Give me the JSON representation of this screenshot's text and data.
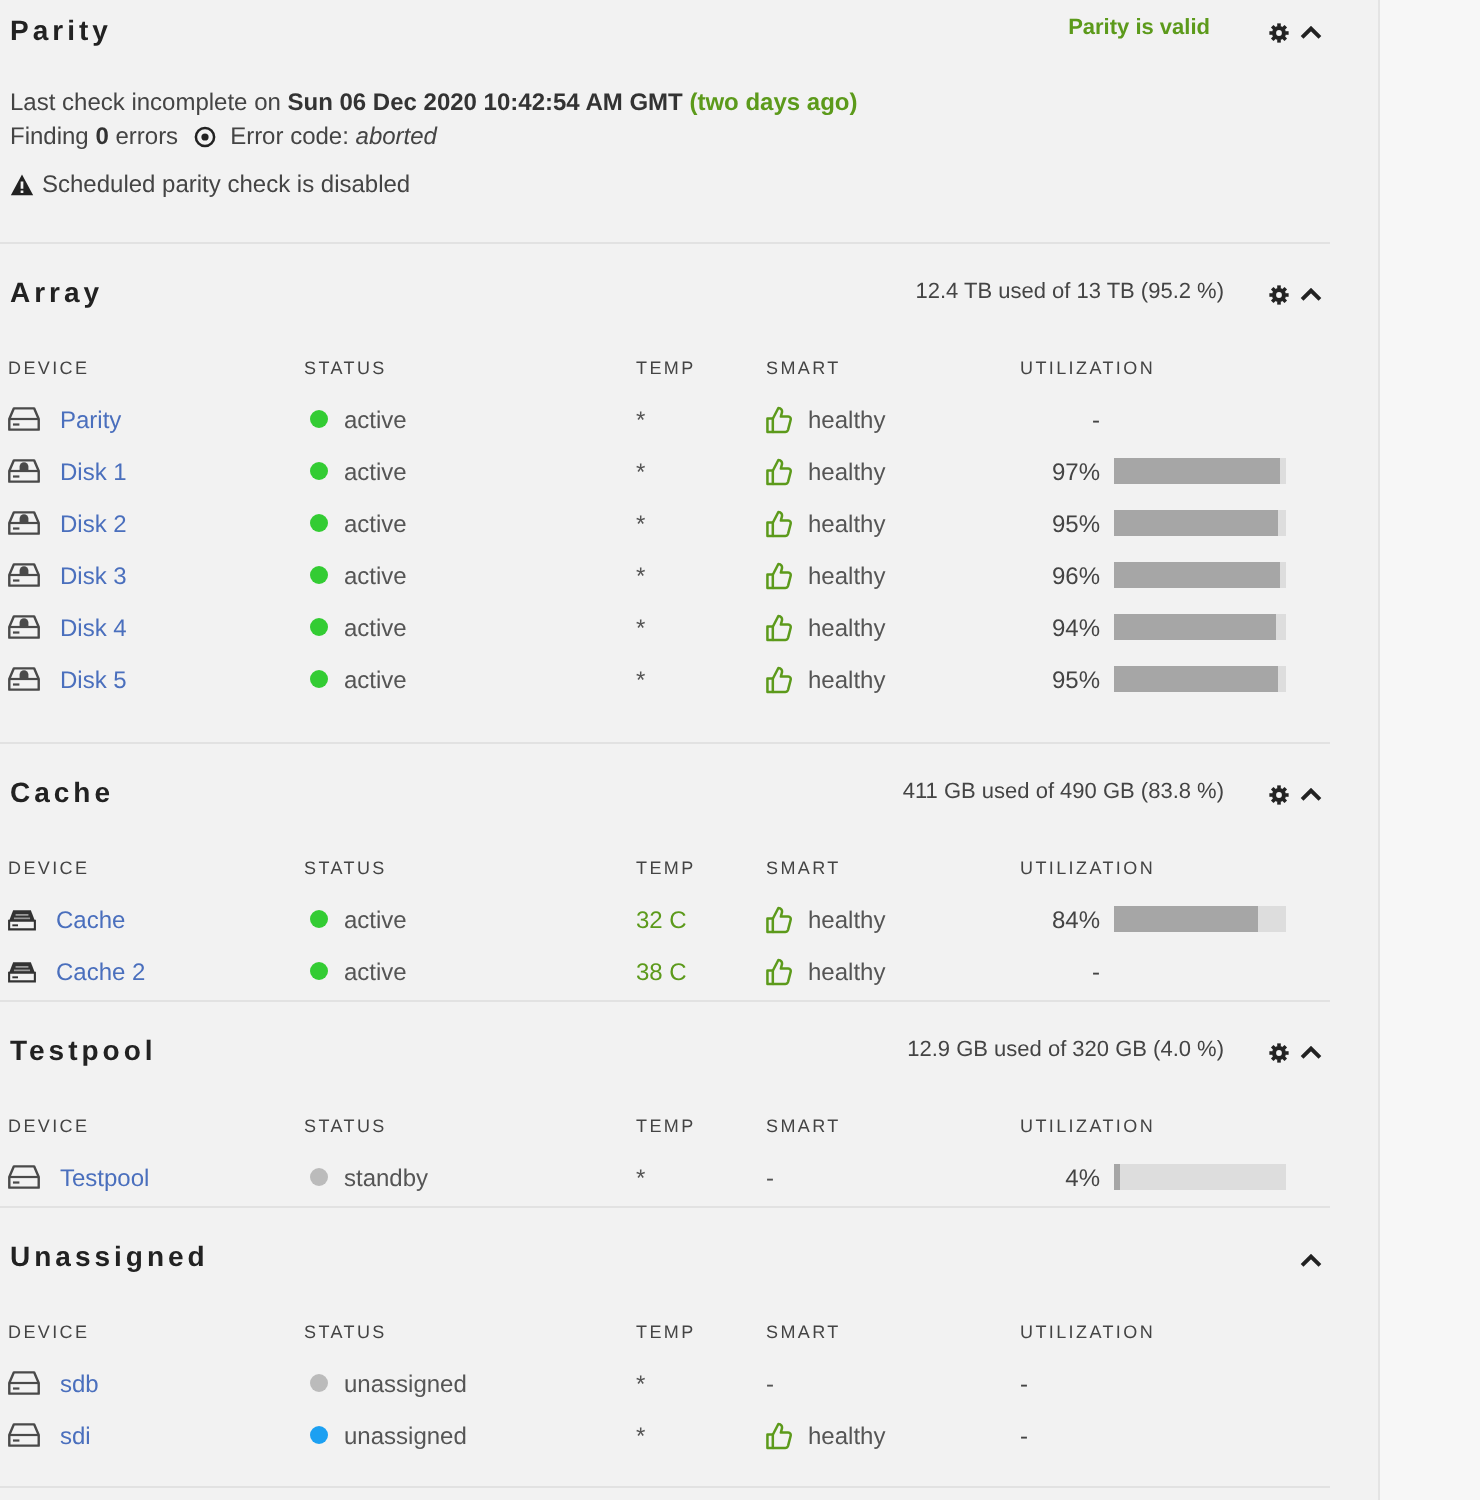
{
  "parity": {
    "title": "Parity",
    "status": "Parity is valid",
    "settings": true,
    "expanded": true,
    "last_check": "Last check incomplete on **Sun 06 Dec 2020 10:42:54 AM GMT**",
    "last_check_age": "(two days ago)",
    "findings": "Finding **0** errors",
    "error_code": "Error code: *aborted*",
    "schedule_warning": "Scheduled parity check is disabled"
  },
  "sections": [
    {
      "kind": "array",
      "title": "Array",
      "usage": "12.4 TB used of 13 TB (95.2 %)",
      "settings": true,
      "expanded": true,
      "columns": [
        "DEVICE",
        "STATUS",
        "TEMP",
        "SMART",
        "UTILIZATION"
      ],
      "devices": [
        {
          "kind": "plain",
          "name": "Parity",
          "status": "active",
          "color": "#33cc33",
          "temp": "*",
          "temp_normal": false,
          "smart": "healthy",
          "smart_ok": true,
          "utilization": "-"
        },
        {
          "kind": "locked",
          "name": "Disk 1",
          "status": "active",
          "color": "#33cc33",
          "temp": "*",
          "temp_normal": false,
          "smart": "healthy",
          "smart_ok": true,
          "utilization": "97%",
          "level": 0.97
        },
        {
          "kind": "locked",
          "name": "Disk 2",
          "status": "active",
          "color": "#33cc33",
          "temp": "*",
          "temp_normal": false,
          "smart": "healthy",
          "smart_ok": true,
          "utilization": "95%",
          "level": 0.95
        },
        {
          "kind": "locked",
          "name": "Disk 3",
          "status": "active",
          "color": "#33cc33",
          "temp": "*",
          "temp_normal": false,
          "smart": "healthy",
          "smart_ok": true,
          "utilization": "96%",
          "level": 0.96
        },
        {
          "kind": "locked",
          "name": "Disk 4",
          "status": "active",
          "color": "#33cc33",
          "temp": "*",
          "temp_normal": false,
          "smart": "healthy",
          "smart_ok": true,
          "utilization": "94%",
          "level": 0.94
        },
        {
          "kind": "locked",
          "name": "Disk 5",
          "status": "active",
          "color": "#33cc33",
          "temp": "*",
          "temp_normal": false,
          "smart": "healthy",
          "smart_ok": true,
          "utilization": "95%",
          "level": 0.95
        }
      ]
    },
    {
      "kind": "pool",
      "title": "Cache",
      "usage": "411 GB used of 490 GB (83.8 %)",
      "settings": true,
      "expanded": true,
      "columns": [
        "DEVICE",
        "STATUS",
        "TEMP",
        "SMART",
        "UTILIZATION"
      ],
      "devices": [
        {
          "kind": "solid",
          "name": "Cache",
          "status": "active",
          "color": "#33cc33",
          "temp": "32 C",
          "temp_normal": true,
          "smart": "healthy",
          "smart_ok": true,
          "utilization": "84%",
          "level": 0.84
        },
        {
          "kind": "solid",
          "name": "Cache 2",
          "status": "active",
          "color": "#33cc33",
          "temp": "38 C",
          "temp_normal": true,
          "smart": "healthy",
          "smart_ok": true,
          "utilization": "-"
        }
      ]
    },
    {
      "kind": "pool",
      "title": "Testpool",
      "usage": "12.9 GB used of 320 GB (4.0 %)",
      "settings": true,
      "expanded": true,
      "columns": [
        "DEVICE",
        "STATUS",
        "TEMP",
        "SMART",
        "UTILIZATION"
      ],
      "devices": [
        {
          "kind": "plain",
          "name": "Testpool",
          "status": "standby",
          "color": "#bbbbbb",
          "temp": "*",
          "temp_normal": false,
          "smart": "-",
          "smart_ok": false,
          "utilization": "4%",
          "level": 0.04
        }
      ]
    },
    {
      "kind": "unassigned",
      "title": "Unassigned",
      "settings": false,
      "expanded": true,
      "columns": [
        "DEVICE",
        "STATUS",
        "TEMP",
        "SMART",
        "UTILIZATION"
      ],
      "devices": [
        {
          "kind": "plain",
          "name": "sdb",
          "status": "unassigned",
          "color": "#bbbbbb",
          "temp": "*",
          "temp_normal": false,
          "smart": "-",
          "smart_ok": false,
          "utilization": "-"
        },
        {
          "kind": "plain",
          "name": "sdi",
          "status": "unassigned",
          "color": "#1ca0f2",
          "temp": "*",
          "temp_normal": false,
          "smart": "healthy",
          "smart_ok": true,
          "utilization": "-"
        }
      ]
    }
  ]
}
